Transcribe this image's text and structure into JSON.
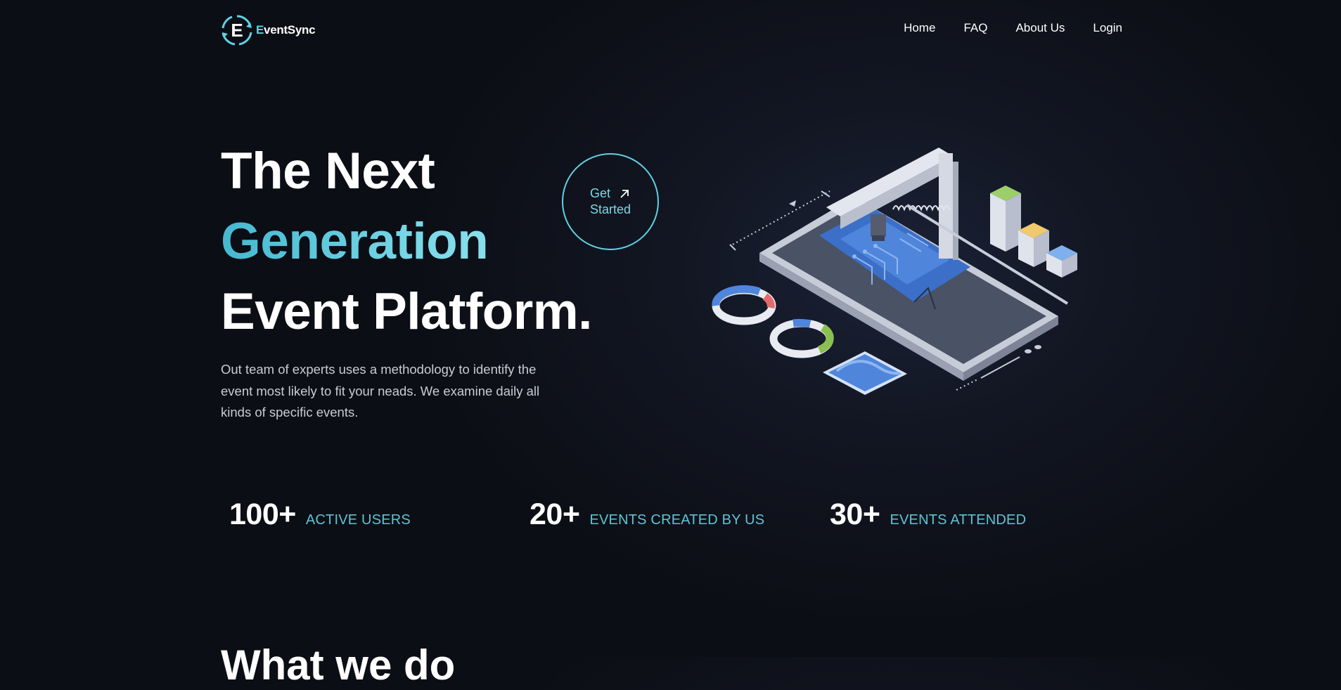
{
  "brand": {
    "name_first": "E",
    "name_rest": "ventSync"
  },
  "nav": {
    "items": [
      "Home",
      "FAQ",
      "About Us",
      "Login"
    ]
  },
  "hero": {
    "title_line1": "The Next",
    "title_line2": "Generation",
    "title_line3": "Event Platform.",
    "description": "Out team of experts uses a methodology to identify the event most likely to fit your neads. We examine daily all kinds of specific events.",
    "cta_line1": "Get",
    "cta_line2": "Started"
  },
  "stats": [
    {
      "value": "100+",
      "label": "ACTIVE USERS"
    },
    {
      "value": "20+",
      "label": "EVENTS CREATED BY US"
    },
    {
      "value": "30+",
      "label": "EVENTS ATTENDED"
    }
  ],
  "next_section": {
    "heading": "What we do"
  },
  "colors": {
    "accent": "#5fd1e4",
    "background": "#0c0e15",
    "text": "#ffffff",
    "muted_text": "#c9ccd4"
  },
  "icons": {
    "logo": "refresh-circle-logo-icon",
    "cta_arrow": "arrow-up-right-icon",
    "illustration": "isometric-phone-chip-illustration"
  }
}
